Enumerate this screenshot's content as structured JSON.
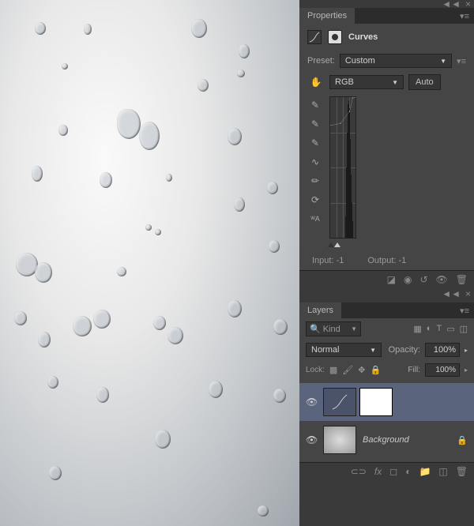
{
  "properties": {
    "tab": "Properties",
    "title": "Curves",
    "preset_label": "Preset:",
    "preset_value": "Custom",
    "channel": "RGB",
    "auto": "Auto",
    "input_label": "Input:",
    "input_value": "-1",
    "output_label": "Output:",
    "output_value": "-1"
  },
  "layers": {
    "tab": "Layers",
    "filter_label": "Kind",
    "blend_mode": "Normal",
    "opacity_label": "Opacity:",
    "opacity_value": "100%",
    "lock_label": "Lock:",
    "fill_label": "Fill:",
    "fill_value": "100%",
    "background_name": "Background"
  },
  "chart_data": {
    "type": "line",
    "title": "Curves",
    "xlabel": "Input",
    "ylabel": "Output",
    "xlim": [
      0,
      255
    ],
    "ylim": [
      0,
      255
    ],
    "points": [
      {
        "x": 0,
        "y": 0
      },
      {
        "x": 105,
        "y": 20
      },
      {
        "x": 195,
        "y": 128
      },
      {
        "x": 225,
        "y": 250
      },
      {
        "x": 255,
        "y": 255
      }
    ],
    "histogram_peak_range": [
      170,
      230
    ]
  }
}
